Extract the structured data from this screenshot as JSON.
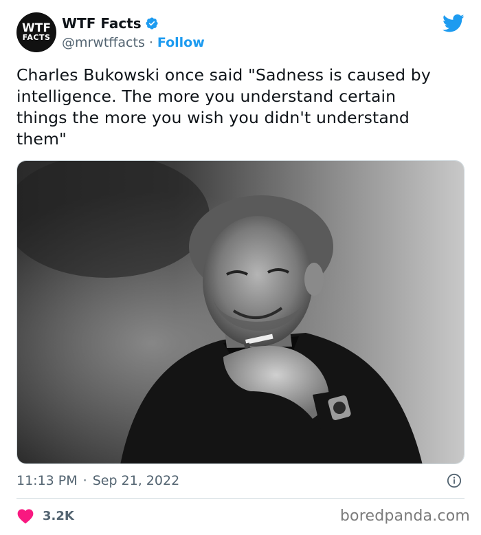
{
  "account": {
    "avatar_line1": "WTF",
    "avatar_line2": "FACTS",
    "display_name": "WTF Facts",
    "handle": "@mrwtffacts",
    "separator": "·",
    "follow_label": "Follow"
  },
  "tweet": {
    "text": "Charles Bukowski once said \"Sadness is caused by\nintelligence. The more you understand certain\nthings the more you wish you didn't understand\nthem\"",
    "time": "11:13 PM",
    "separator": "·",
    "date": "Sep 21, 2022",
    "like_count": "3.2K"
  },
  "watermark": "boredpanda.com",
  "icons": {
    "verified": "verified-badge-icon",
    "platform": "twitter-bird-icon",
    "info": "info-icon",
    "like": "heart-icon"
  },
  "colors": {
    "accent": "#1d9bf0",
    "like": "#f91880",
    "secondary_text": "#536471",
    "divider": "#cfd9de"
  }
}
